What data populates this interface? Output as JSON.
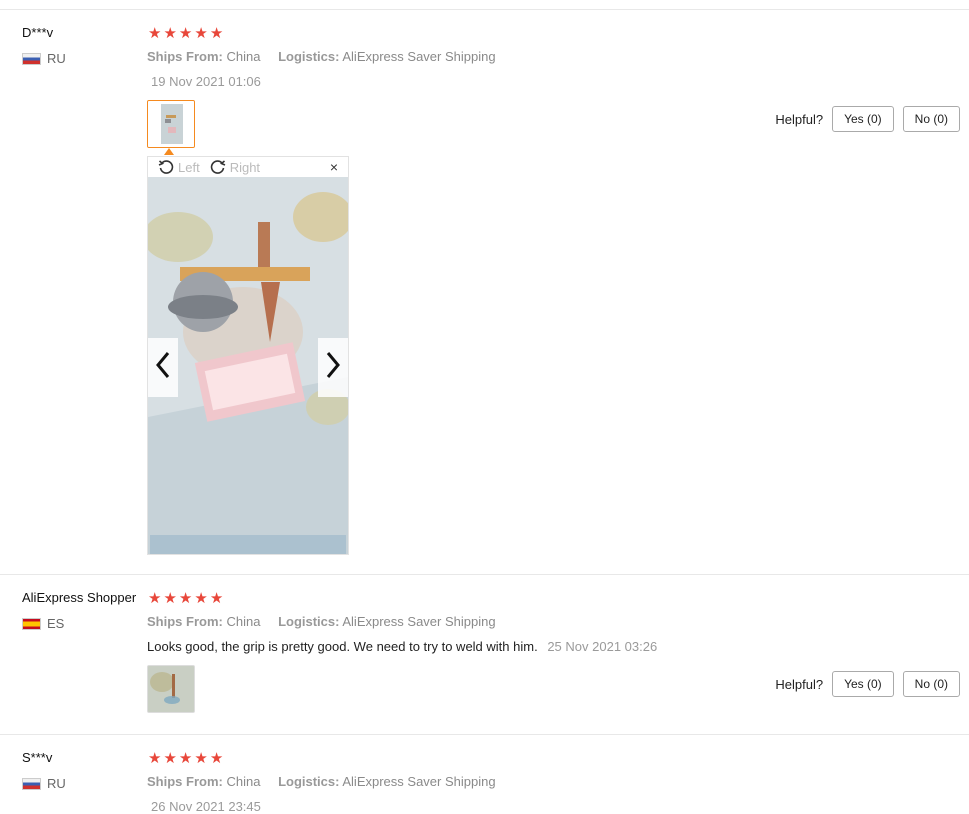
{
  "labels": {
    "ships_from": "Ships From:",
    "logistics": "Logistics:",
    "helpful": "Helpful?",
    "yes": "Yes (0)",
    "no": "No (0)",
    "viewer_left": "Left",
    "viewer_right": "Right",
    "viewer_close": "×"
  },
  "reviews": [
    {
      "user": "D***v",
      "country": "RU",
      "rating": 5,
      "ships_from": "China",
      "logistics": "AliExpress Saver Shipping",
      "text": "",
      "date": "19 Nov 2021 01:06"
    },
    {
      "user": "AliExpress Shopper",
      "country": "ES",
      "rating": 5,
      "ships_from": "China",
      "logistics": "AliExpress Saver Shipping",
      "text": "Looks good, the grip is pretty good. We need to try to weld with him.",
      "date": "25 Nov 2021 03:26"
    },
    {
      "user": "S***v",
      "country": "RU",
      "rating": 5,
      "ships_from": "China",
      "logistics": "AliExpress Saver Shipping",
      "text": "",
      "date": "26 Nov 2021 23:45"
    }
  ],
  "icons": {
    "rotate_left": "rotate-left-icon",
    "rotate_right": "rotate-right-icon",
    "prev": "chevron-left-icon",
    "next": "chevron-right-icon",
    "close": "close-icon",
    "star": "star-icon"
  },
  "colors": {
    "star": "#e8473a",
    "selected_thumb": "#f58a1f"
  }
}
